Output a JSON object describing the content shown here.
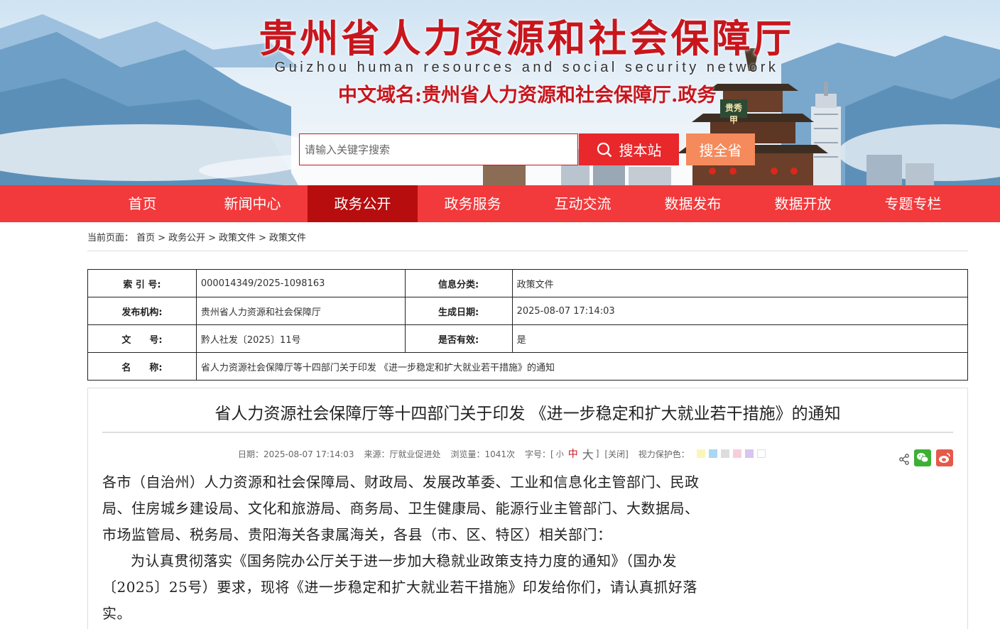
{
  "header": {
    "title": "贵州省人力资源和社会保障厅",
    "subtitle": "Guizhou human resources and social security network",
    "domain": "中文域名:贵州省人力资源和社会保障厅.政务",
    "plaque": "贵秀甲",
    "search": {
      "placeholder": "请输入关键字搜索",
      "site_button": "搜本站",
      "province_button": "搜全省"
    }
  },
  "nav": {
    "items": [
      "首页",
      "新闻中心",
      "政务公开",
      "政务服务",
      "互动交流",
      "数据发布",
      "数据开放",
      "专题专栏"
    ],
    "active": "政务公开"
  },
  "breadcrumb": {
    "label": "当前页面：",
    "items": [
      "首页",
      "政务公开",
      "政策文件",
      "政策文件"
    ],
    "separator": ">"
  },
  "info": {
    "index_label": "索 引 号:",
    "index_value": "000014349/2025-1098163",
    "category_label": "信息分类:",
    "category_value": "政策文件",
    "issuer_label": "发布机构:",
    "issuer_value": "贵州省人力资源和社会保障厅",
    "date_label": "生成日期:",
    "date_value": "2025-08-07 17:14:03",
    "docno_label": "文　　号:",
    "docno_value": "黔人社发〔2025〕11号",
    "valid_label": "是否有效:",
    "valid_value": "是",
    "name_label": "名　　称:",
    "name_value": "省人力资源社会保障厅等十四部门关于印发 《进一步稳定和扩大就业若干措施》的通知"
  },
  "article": {
    "title": "省人力资源社会保障厅等十四部门关于印发 《进一步稳定和扩大就业若干措施》的通知",
    "meta": {
      "date": "日期：2025-08-07 17:14:03",
      "source": "来源：厅就业促进处",
      "views": "浏览量：1041次",
      "font_label": "字号：[",
      "font_small": "小",
      "font_mid": "中",
      "font_big": "大",
      "font_end": "]",
      "close": "[关闭]",
      "eye_label": "视力保护色："
    },
    "eye_colors": [
      "#fbf6b8",
      "#a9d8f2",
      "#dddddd",
      "#f6cfdc",
      "#d8c5f1",
      "#ffffff"
    ],
    "paragraphs": [
      "各市（自治州）人力资源和社会保障局、财政局、发展改革委、工业和信息化主管部门、民政局、住房城乡建设局、文化和旅游局、商务局、卫生健康局、能源行业主管部门、大数据局、市场监管局、税务局、贵阳海关各隶属海关，各县（市、区、特区）相关部门：",
      "为认真贯彻落实《国务院办公厅关于进一步加大稳就业政策支持力度的通知》（国办发〔2025〕25号）要求，现将《进一步稳定和扩大就业若干措施》印发给你们，请认真抓好落实。"
    ]
  },
  "colors": {
    "brand_red": "#c8161d",
    "nav_bg": "#f2393b",
    "nav_active": "#b70d0e",
    "search_site": "#e8282b",
    "search_province": "#f58a5c"
  }
}
